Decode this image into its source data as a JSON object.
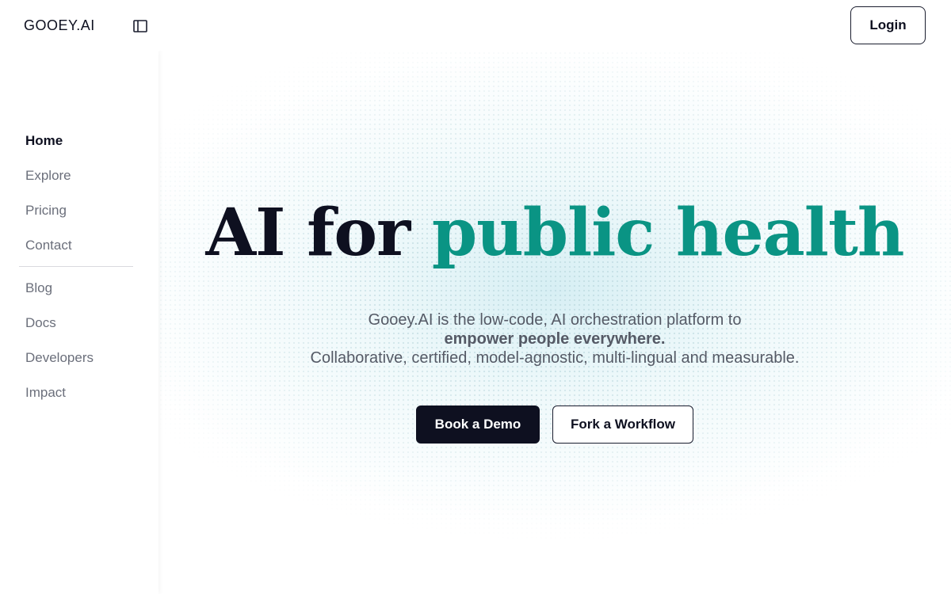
{
  "header": {
    "logo": "GOOEY.AI",
    "sidebar_toggle_icon": "sidebar-panel-icon",
    "login_label": "Login"
  },
  "sidebar": {
    "items": [
      {
        "label": "Home",
        "active": true
      },
      {
        "label": "Explore"
      },
      {
        "label": "Pricing"
      },
      {
        "label": "Contact"
      },
      {
        "label": "Blog"
      },
      {
        "label": "Docs"
      },
      {
        "label": "Developers"
      },
      {
        "label": "Impact"
      }
    ]
  },
  "hero": {
    "headline_plain": "AI for",
    "headline_accent": "public health",
    "line1": "Gooey.AI is the low-code, AI orchestration platform to",
    "line2": "empower people everywhere.",
    "line3": "Collaborative, certified, model-agnostic, multi-lingual and measurable.",
    "primary_cta": "Book a Demo",
    "secondary_cta": "Fork a Workflow"
  },
  "colors": {
    "accent": "#0a9484",
    "ink": "#0e1020",
    "muted": "#6b6f7b"
  }
}
